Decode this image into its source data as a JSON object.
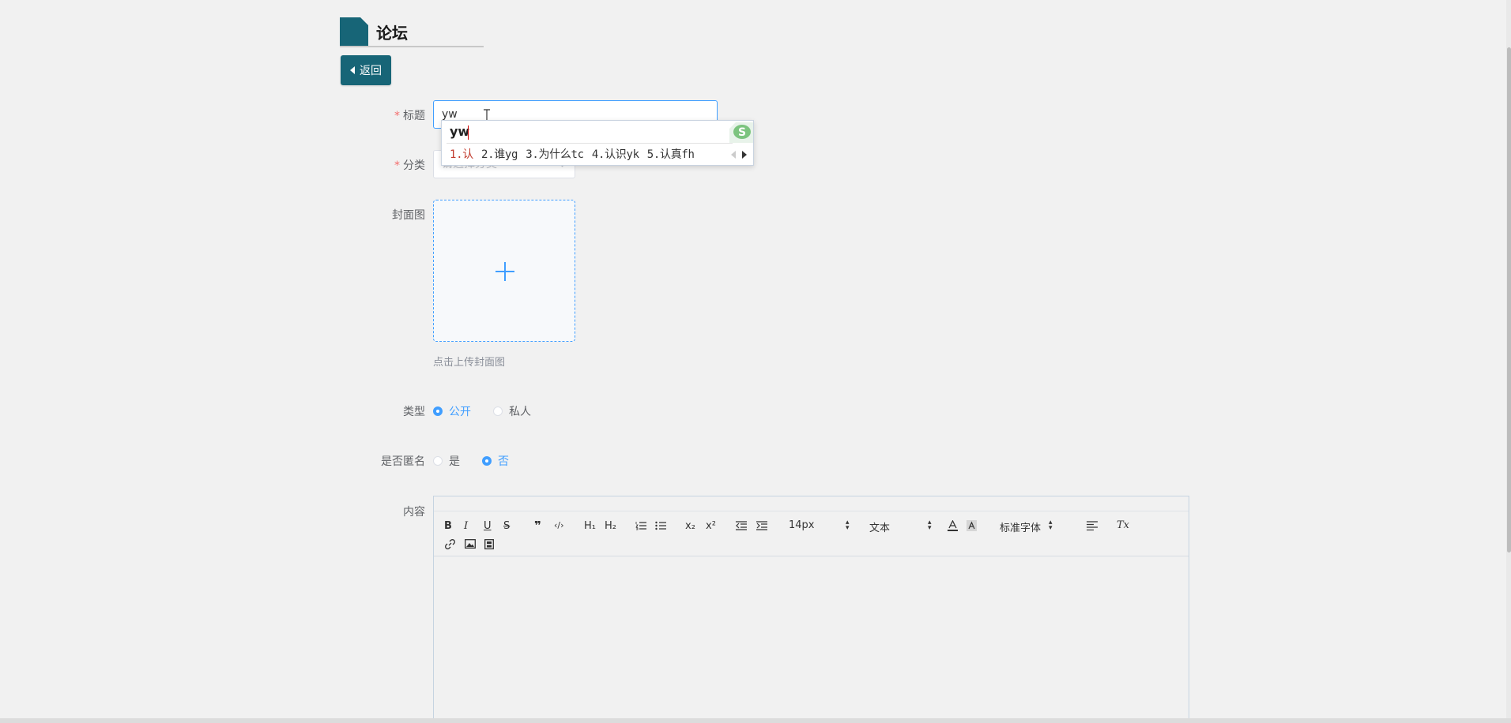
{
  "header": {
    "title": "论坛"
  },
  "back_button": {
    "label": "返回"
  },
  "form": {
    "title": {
      "label": "标题",
      "value": "yw"
    },
    "category": {
      "label": "分类",
      "placeholder": "请选择分类"
    },
    "cover": {
      "label": "封面图",
      "hint": "点击上传封面图"
    },
    "type": {
      "label": "类型",
      "options": [
        "公开",
        "私人"
      ],
      "selected": "公开"
    },
    "anonymous": {
      "label": "是否匿名",
      "options": [
        "是",
        "否"
      ],
      "selected": "否"
    },
    "content": {
      "label": "内容"
    }
  },
  "ime": {
    "composition": "yw",
    "candidates": [
      "1.认",
      "2.谁yg",
      "3.为什么tc",
      "4.认识yk",
      "5.认真fh"
    ],
    "logo_letter": "S"
  },
  "editor": {
    "toolbar": {
      "row1": [
        "B",
        "I",
        "U",
        "S",
        "❞",
        "‹/›",
        "H₁",
        "H₂",
        "list-ordered",
        "list-bullet",
        "x₂",
        "x²",
        "indent-left",
        "indent-right"
      ],
      "font_size": "14px",
      "header_select": "文本",
      "font_family": "标准字体",
      "clean": "Tx"
    }
  },
  "colors": {
    "primary": "#176577",
    "accent": "#409eff",
    "required": "#f56c6c"
  }
}
